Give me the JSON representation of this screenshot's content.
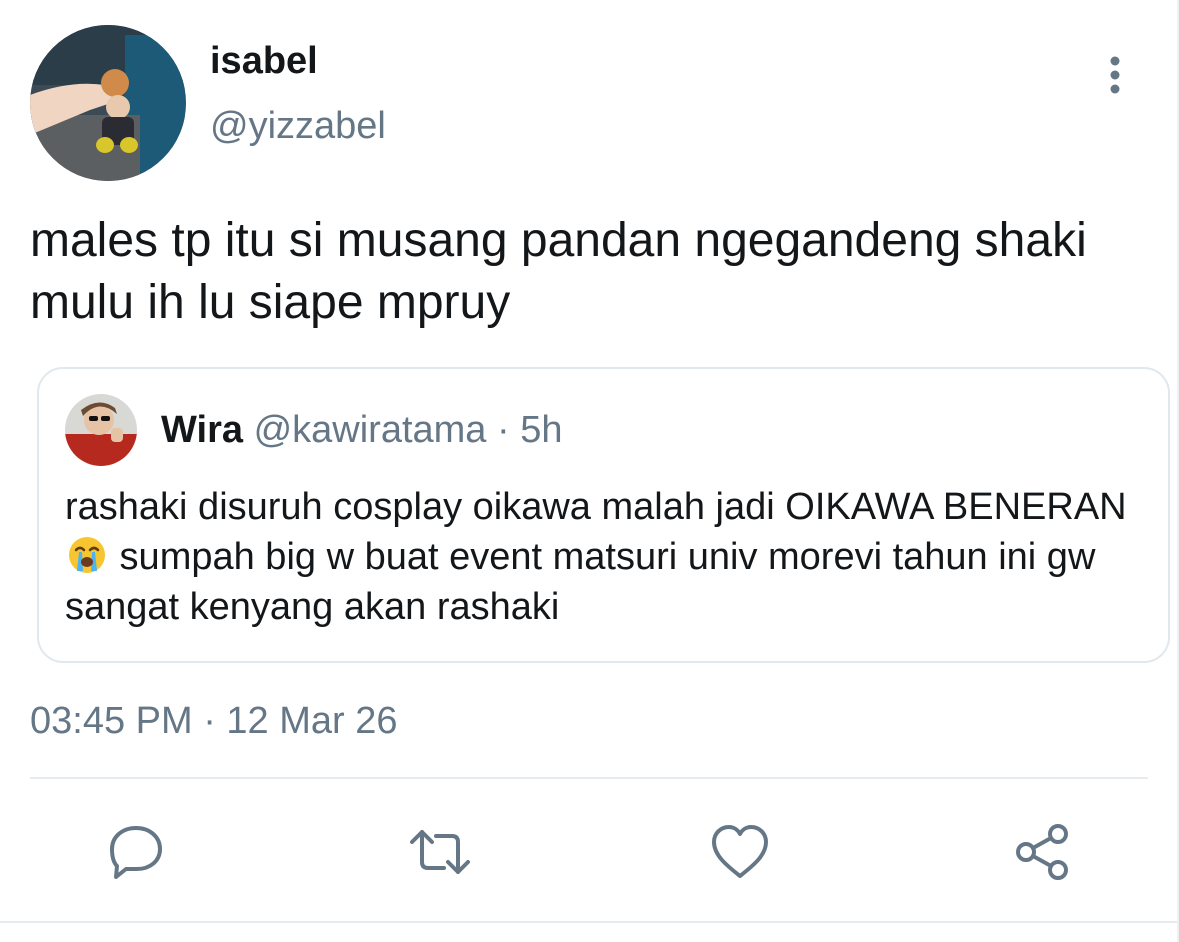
{
  "tweet": {
    "author": {
      "name": "isabel",
      "handle": "@yizzabel",
      "avatar": "photo-avatar"
    },
    "text": "males tp itu si musang pandan ngegandeng shaki mulu ih lu siape mpruy",
    "timestamp": "03:45 PM · 12 Mar 26"
  },
  "quoted": {
    "author": {
      "name": "Wira",
      "handle": "@kawiratama",
      "separator": "·",
      "time": "5h",
      "avatar": "photo-avatar"
    },
    "text_before_emoji": "rashaki disuruh cosplay oikawa malah jadi OIKAWA BENERAN",
    "emoji": "loudly-crying-face",
    "text_after_emoji": " sumpah big w buat event matsuri univ morevi tahun ini gw sangat kenyang akan rashaki"
  },
  "actions": [
    {
      "name": "reply",
      "icon": "reply-icon"
    },
    {
      "name": "retweet",
      "icon": "retweet-icon"
    },
    {
      "name": "like",
      "icon": "heart-icon"
    },
    {
      "name": "share",
      "icon": "share-icon"
    }
  ],
  "colors": {
    "text": "#14171a",
    "secondary": "#657786",
    "border": "#e1e8ed",
    "icon": "#657786"
  }
}
